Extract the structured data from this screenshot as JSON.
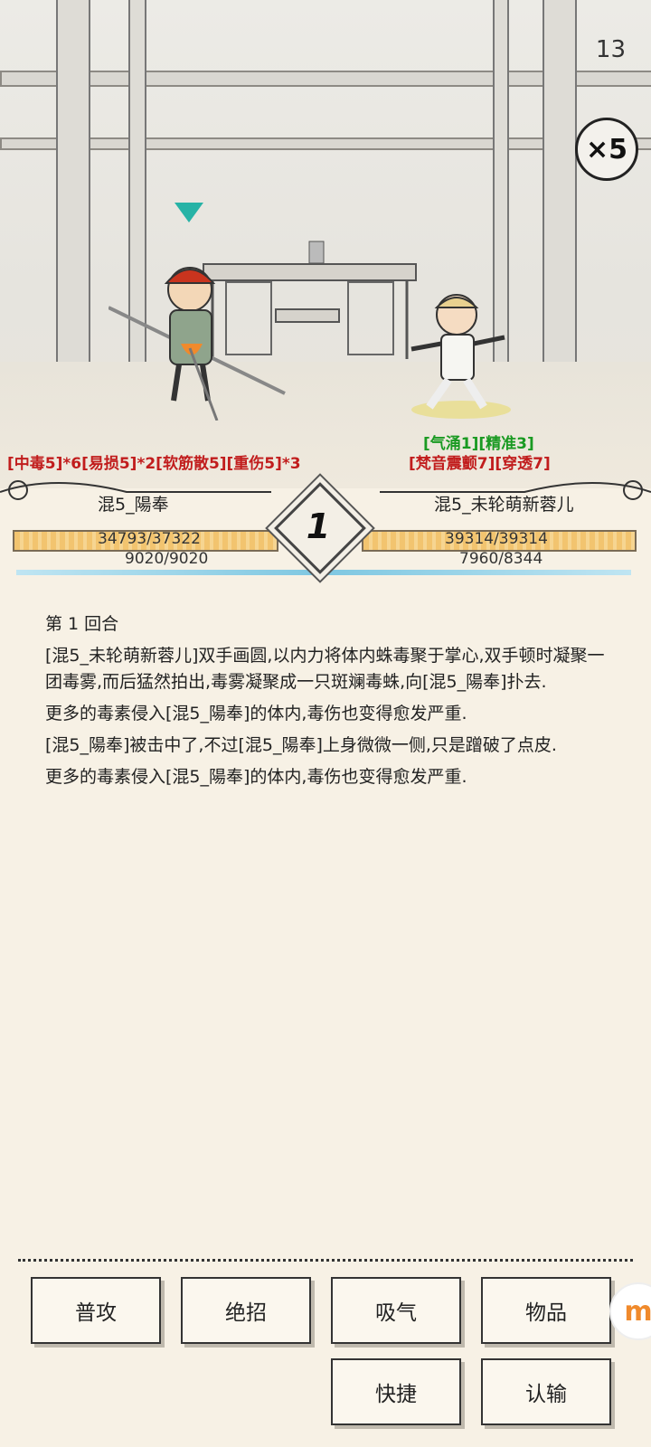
{
  "hud": {
    "round_counter": "13",
    "speed": "×5"
  },
  "left_fighter": {
    "name": "混5_陽奉",
    "status_effects": "[中毒5]*6[易损5]*2[软筋散5][重伤5]*3",
    "hp": "34793/37322",
    "hp_fraction": 0.932,
    "mp": "9020/9020",
    "mp_fraction": 1.0
  },
  "right_fighter": {
    "name": "混5_未轮萌新蓉儿",
    "buffs": "[气涌1][精准3]",
    "debuffs": "[梵音震颤7][穿透7]",
    "hp": "39314/39314",
    "hp_fraction": 1.0,
    "mp": "7960/8344",
    "mp_fraction": 0.954
  },
  "round_badge": "1",
  "log": [
    "第 1 回合",
    "[混5_未轮萌新蓉儿]双手画圆,以内力将体内蛛毒聚于掌心,双手顿时凝聚一团毒雾,而后猛然拍出,毒雾凝聚成一只斑斓毒蛛,向[混5_陽奉]扑去.",
    "更多的毒素侵入[混5_陽奉]的体内,毒伤也变得愈发严重.",
    "[混5_陽奉]被击中了,不过[混5_陽奉]上身微微一侧,只是蹭破了点皮.",
    "更多的毒素侵入[混5_陽奉]的体内,毒伤也变得愈发严重."
  ],
  "actions": {
    "attack": "普攻",
    "ultimate": "绝招",
    "breathe": "吸气",
    "items": "物品",
    "shortcut": "快捷",
    "surrender": "认输"
  },
  "colors": {
    "hp_bar": "#f2c46f",
    "mp_line": "#7ec7e1",
    "debuff_text": "#c11d1d",
    "buff_text": "#1a9a22",
    "target_marker": "#27b3a6"
  }
}
